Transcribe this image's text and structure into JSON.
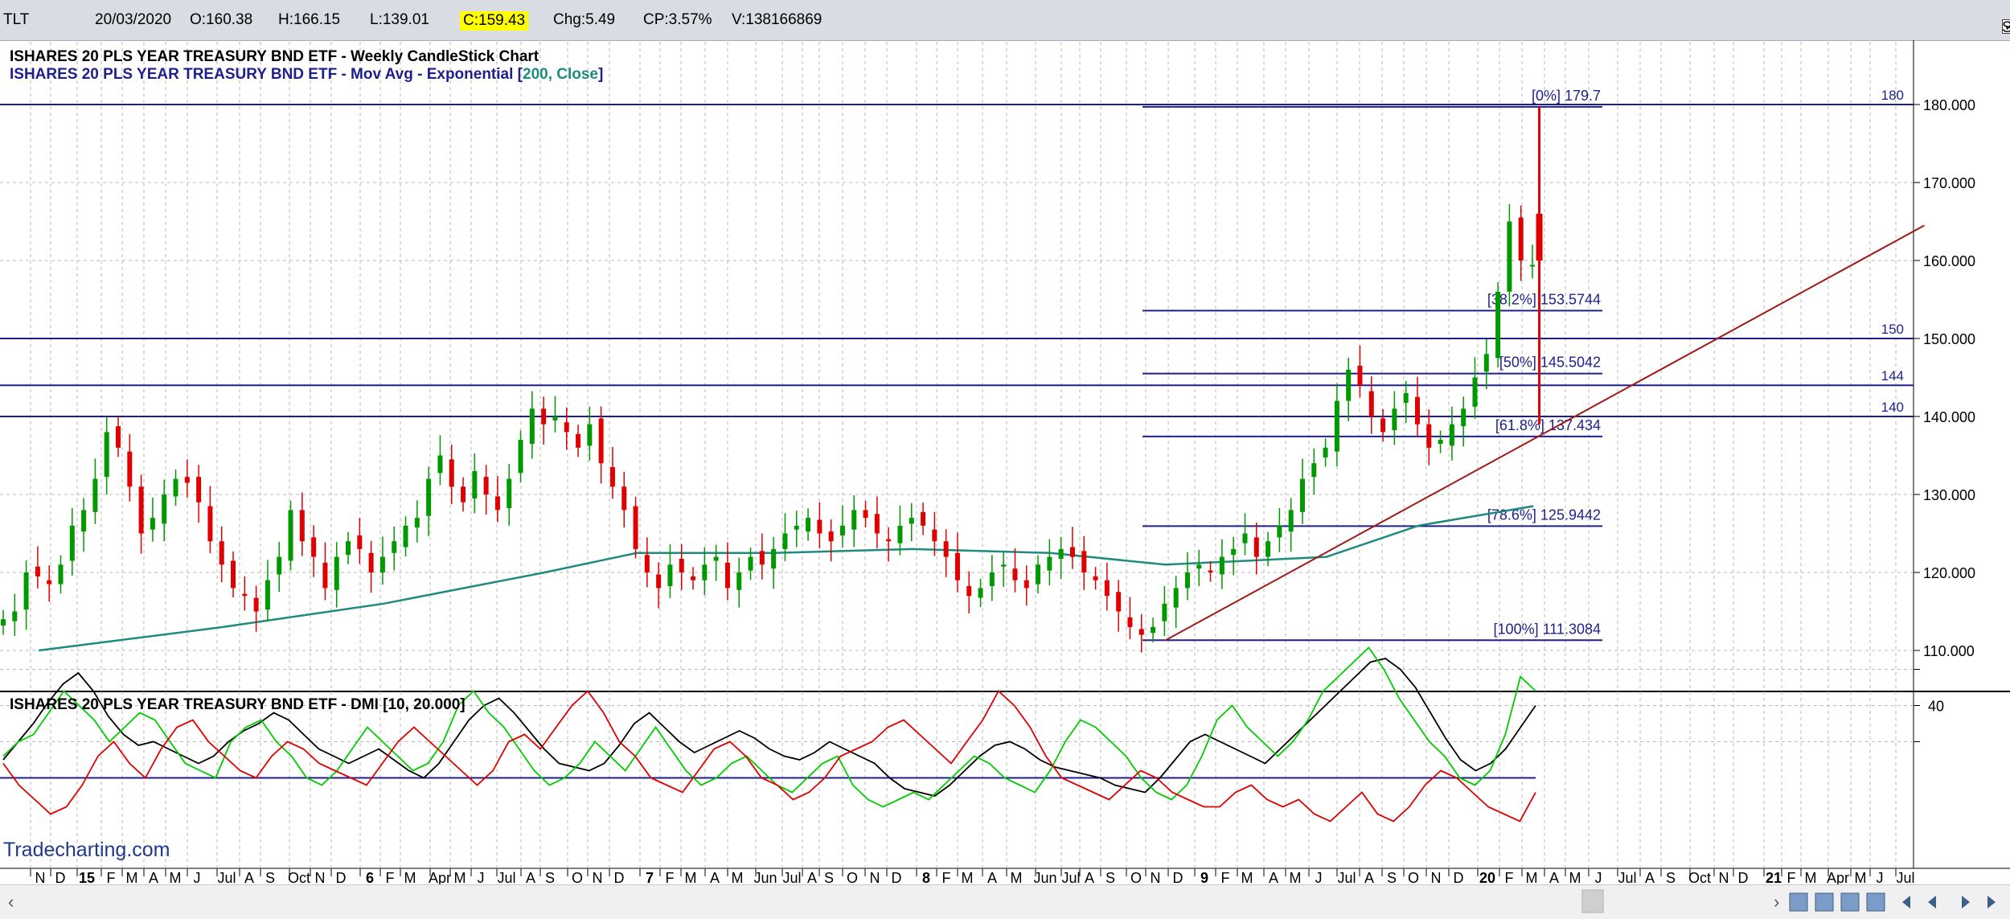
{
  "header": {
    "symbol": "TLT",
    "date": "20/03/2020",
    "open": "O:160.38",
    "high": "H:166.15",
    "low": "L:139.01",
    "close": "C:159.43",
    "change": "Chg:5.49",
    "change_pct": "CP:3.57%",
    "volume": "V:138166869",
    "show_last_label": "Show Last",
    "show_last_checked": true
  },
  "colors": {
    "up": "#009900",
    "down": "#e00000",
    "ema": "#1e8a80",
    "hline": "#1f1f8c",
    "trend": "#a01818",
    "plus_di": "#00cc00",
    "minus_di": "#e00000",
    "adx": "#000000",
    "grid": "#b8b8b8"
  },
  "icons": [
    "scroll-left-icon",
    "scroll-right-icon",
    "toolbar-icons",
    "nav-arrows-icon"
  ],
  "watermark": "Tradecharting.com",
  "chart_data": [
    {
      "type": "candlestick",
      "title": "ISHARES 20 PLS YEAR TREASURY BND ETF - Weekly CandleStick Chart",
      "subtitle_prefix": "ISHARES 20 PLS YEAR TREASURY BND ETF - Mov Avg - Exponential [",
      "subtitle_params": "200, Close",
      "subtitle_suffix": "]",
      "ylim": [
        105,
        185
      ],
      "y_ticks": [
        "110.000",
        "120.000",
        "130.000",
        "140.000",
        "150.000",
        "160.000",
        "170.000",
        "180.000"
      ],
      "horizontal_lines": [
        {
          "value": 180,
          "label": "180"
        },
        {
          "value": 150,
          "label": "150"
        },
        {
          "value": 144,
          "label": "144"
        },
        {
          "value": 140,
          "label": "140"
        }
      ],
      "fibonacci": {
        "start": "2018-10",
        "end": "2020-06",
        "levels": [
          {
            "value": 179.7,
            "label": "[0%] 179.7"
          },
          {
            "value": 153.5744,
            "label": "[38.2%] 153.5744"
          },
          {
            "value": 145.5042,
            "label": "[50%] 145.5042"
          },
          {
            "value": 137.434,
            "label": "[61.8%] 137.434"
          },
          {
            "value": 125.9442,
            "label": "[78.6%] 125.9442"
          },
          {
            "value": 111.3084,
            "label": "[100%] 111.3084"
          }
        ]
      },
      "trendline": {
        "from": {
          "x": "2018-11",
          "y": 111.3
        },
        "to": {
          "x": "2021-08",
          "y": 164.5
        }
      },
      "weekly_close": [
        114,
        115,
        120,
        119.5,
        118.5,
        121,
        126,
        128,
        132,
        138,
        136,
        131,
        125,
        127,
        130,
        132,
        131.5,
        129,
        124,
        121,
        118,
        117,
        115,
        119,
        122,
        128,
        124,
        122,
        118,
        122,
        124,
        123,
        120,
        122,
        124,
        126,
        127,
        132,
        135,
        131,
        129,
        133,
        130,
        128,
        132,
        137,
        141,
        139,
        140,
        138,
        136,
        139,
        134,
        131,
        128,
        123,
        120,
        118,
        121,
        120,
        119,
        121,
        122,
        118,
        120,
        122,
        121,
        123,
        125,
        126,
        127,
        125,
        124,
        126,
        128,
        127,
        125,
        124,
        126,
        127,
        126,
        124,
        122,
        119,
        117,
        118,
        120,
        121,
        119,
        118,
        121,
        122,
        123,
        122,
        120,
        119,
        117,
        115,
        113,
        112,
        113,
        116,
        118,
        120,
        121,
        120,
        122,
        123,
        125,
        122,
        124,
        126,
        128,
        132,
        134,
        136,
        142,
        146,
        144,
        140,
        138,
        141,
        143,
        139,
        136,
        137,
        139,
        141,
        145,
        148,
        156,
        165,
        160,
        159.43
      ],
      "weekly_high": [],
      "ema200": [
        {
          "x": "2014-10",
          "y": 110
        },
        {
          "x": "2015-06",
          "y": 113
        },
        {
          "x": "2016-01",
          "y": 116
        },
        {
          "x": "2016-08",
          "y": 120
        },
        {
          "x": "2016-12",
          "y": 122.5
        },
        {
          "x": "2017-06",
          "y": 122.5
        },
        {
          "x": "2017-12",
          "y": 123
        },
        {
          "x": "2018-06",
          "y": 122.5
        },
        {
          "x": "2018-11",
          "y": 121
        },
        {
          "x": "2019-06",
          "y": 122
        },
        {
          "x": "2019-10",
          "y": 126
        },
        {
          "x": "2020-03",
          "y": 128.5
        }
      ],
      "spike_week": {
        "x": "2020-03-09",
        "open": 166,
        "high": 179.7,
        "low": 139.01,
        "close": 160
      }
    },
    {
      "type": "line",
      "title": "ISHARES 20 PLS YEAR TREASURY BND ETF - DMI [10, 20.000]",
      "y_ticks": [
        "40"
      ],
      "threshold": 20,
      "ylim": [
        5,
        60
      ],
      "series": [
        {
          "key": "adx",
          "values": [
            25,
            30,
            35,
            41,
            46,
            49,
            44,
            37,
            32,
            29,
            30,
            28,
            26,
            24,
            26,
            30,
            33,
            35,
            38,
            36,
            32,
            28,
            26,
            24,
            26,
            28,
            25,
            22,
            20,
            24,
            30,
            36,
            40,
            42,
            38,
            33,
            28,
            24,
            23,
            22,
            24,
            29,
            35,
            38,
            34,
            30,
            27,
            29,
            31,
            33,
            31,
            28,
            26,
            25,
            27,
            30,
            28,
            26,
            24,
            20,
            17,
            16,
            15,
            18,
            22,
            26,
            29,
            30,
            28,
            25,
            23,
            22,
            21,
            20,
            18,
            17,
            16,
            20,
            25,
            30,
            32,
            30,
            28,
            26,
            24,
            28,
            32,
            36,
            40,
            44,
            48,
            52,
            53,
            50,
            45,
            38,
            31,
            25,
            22,
            24,
            28,
            34,
            40
          ]
        },
        {
          "key": "plus_di",
          "values": [
            26,
            30,
            32,
            38,
            44,
            40,
            36,
            30,
            34,
            38,
            36,
            30,
            24,
            22,
            20,
            30,
            34,
            36,
            30,
            26,
            20,
            18,
            22,
            28,
            34,
            30,
            26,
            22,
            24,
            30,
            40,
            44,
            38,
            34,
            28,
            22,
            18,
            20,
            24,
            30,
            26,
            22,
            28,
            34,
            28,
            22,
            18,
            20,
            24,
            26,
            22,
            18,
            16,
            20,
            24,
            26,
            18,
            14,
            12,
            14,
            16,
            14,
            18,
            22,
            26,
            24,
            20,
            18,
            16,
            22,
            30,
            36,
            34,
            30,
            26,
            20,
            16,
            14,
            18,
            26,
            36,
            40,
            34,
            30,
            26,
            30,
            36,
            44,
            48,
            52,
            56,
            50,
            42,
            36,
            30,
            26,
            20,
            18,
            22,
            32,
            48,
            44
          ]
        },
        {
          "key": "minus_di",
          "values": [
            24,
            18,
            14,
            10,
            12,
            18,
            26,
            30,
            24,
            20,
            28,
            34,
            36,
            30,
            26,
            22,
            20,
            26,
            30,
            28,
            24,
            22,
            20,
            18,
            24,
            30,
            34,
            30,
            26,
            22,
            18,
            22,
            30,
            32,
            28,
            34,
            40,
            44,
            38,
            30,
            26,
            20,
            18,
            16,
            22,
            28,
            30,
            26,
            20,
            18,
            14,
            16,
            20,
            26,
            28,
            30,
            34,
            36,
            32,
            28,
            24,
            30,
            36,
            44,
            40,
            34,
            26,
            20,
            18,
            16,
            14,
            18,
            22,
            20,
            16,
            14,
            12,
            12,
            16,
            18,
            14,
            12,
            14,
            10,
            8,
            12,
            16,
            10,
            8,
            12,
            18,
            22,
            20,
            16,
            12,
            10,
            8,
            16
          ]
        }
      ]
    }
  ],
  "x_axis": {
    "labels": [
      {
        "x": 50,
        "t": "N",
        "bold": false
      },
      {
        "x": 75,
        "t": "D",
        "bold": false
      },
      {
        "x": 108,
        "t": "15",
        "bold": true
      },
      {
        "x": 138,
        "t": "F",
        "bold": false
      },
      {
        "x": 164,
        "t": "M",
        "bold": false
      },
      {
        "x": 191,
        "t": "A",
        "bold": false
      },
      {
        "x": 218,
        "t": "M",
        "bold": false
      },
      {
        "x": 245,
        "t": "J",
        "bold": false
      },
      {
        "x": 282,
        "t": "Jul",
        "bold": false
      },
      {
        "x": 310,
        "t": "A",
        "bold": false
      },
      {
        "x": 336,
        "t": "S",
        "bold": false
      },
      {
        "x": 372,
        "t": "Oct",
        "bold": false
      },
      {
        "x": 398,
        "t": "N",
        "bold": false
      },
      {
        "x": 424,
        "t": "D",
        "bold": false
      },
      {
        "x": 460,
        "t": "6",
        "bold": true
      },
      {
        "x": 485,
        "t": "F",
        "bold": false
      },
      {
        "x": 510,
        "t": "M",
        "bold": false
      },
      {
        "x": 547,
        "t": "Apr",
        "bold": false
      },
      {
        "x": 572,
        "t": "M",
        "bold": false
      },
      {
        "x": 598,
        "t": "J",
        "bold": false
      },
      {
        "x": 630,
        "t": "Jul",
        "bold": false
      },
      {
        "x": 660,
        "t": "A",
        "bold": false
      },
      {
        "x": 684,
        "t": "S",
        "bold": false
      },
      {
        "x": 718,
        "t": "O",
        "bold": false
      },
      {
        "x": 743,
        "t": "N",
        "bold": false
      },
      {
        "x": 770,
        "t": "D",
        "bold": false
      },
      {
        "x": 808,
        "t": "7",
        "bold": true
      },
      {
        "x": 833,
        "t": "F",
        "bold": false
      },
      {
        "x": 859,
        "t": "M",
        "bold": false
      },
      {
        "x": 889,
        "t": "A",
        "bold": false
      },
      {
        "x": 917,
        "t": "M",
        "bold": false
      },
      {
        "x": 952,
        "t": "Jun",
        "bold": false
      },
      {
        "x": 985,
        "t": "Jul",
        "bold": false
      },
      {
        "x": 1010,
        "t": "A",
        "bold": false
      },
      {
        "x": 1031,
        "t": "S",
        "bold": false
      },
      {
        "x": 1060,
        "t": "O",
        "bold": false
      },
      {
        "x": 1088,
        "t": "N",
        "bold": false
      },
      {
        "x": 1115,
        "t": "D",
        "bold": false
      },
      {
        "x": 1152,
        "t": "8",
        "bold": true
      },
      {
        "x": 1177,
        "t": "F",
        "bold": false
      },
      {
        "x": 1203,
        "t": "M",
        "bold": false
      },
      {
        "x": 1234,
        "t": "A",
        "bold": false
      },
      {
        "x": 1264,
        "t": "M",
        "bold": false
      },
      {
        "x": 1300,
        "t": "Jun",
        "bold": false
      },
      {
        "x": 1332,
        "t": "Jul",
        "bold": false
      },
      {
        "x": 1355,
        "t": "A",
        "bold": false
      },
      {
        "x": 1381,
        "t": "S",
        "bold": false
      },
      {
        "x": 1413,
        "t": "O",
        "bold": false
      },
      {
        "x": 1437,
        "t": "N",
        "bold": false
      },
      {
        "x": 1465,
        "t": "D",
        "bold": false
      },
      {
        "x": 1498,
        "t": "9",
        "bold": true
      },
      {
        "x": 1524,
        "t": "F",
        "bold": false
      },
      {
        "x": 1551,
        "t": "M",
        "bold": false
      },
      {
        "x": 1584,
        "t": "A",
        "bold": false
      },
      {
        "x": 1611,
        "t": "M",
        "bold": false
      },
      {
        "x": 1640,
        "t": "J",
        "bold": false
      },
      {
        "x": 1675,
        "t": "Jul",
        "bold": false
      },
      {
        "x": 1703,
        "t": "A",
        "bold": false
      },
      {
        "x": 1731,
        "t": "S",
        "bold": false
      },
      {
        "x": 1758,
        "t": "O",
        "bold": false
      },
      {
        "x": 1786,
        "t": "N",
        "bold": false
      },
      {
        "x": 1814,
        "t": "D",
        "bold": false
      },
      {
        "x": 1850,
        "t": "20",
        "bold": true
      },
      {
        "x": 1877,
        "t": "F",
        "bold": false
      },
      {
        "x": 1905,
        "t": "M",
        "bold": false
      },
      {
        "x": 1933,
        "t": "A",
        "bold": false
      },
      {
        "x": 1959,
        "t": "M",
        "bold": false
      },
      {
        "x": 1988,
        "t": "J",
        "bold": false
      },
      {
        "x": 2024,
        "t": "Jul",
        "bold": false
      },
      {
        "x": 2052,
        "t": "A",
        "bold": false
      },
      {
        "x": 2078,
        "t": "S",
        "bold": false
      },
      {
        "x": 2114,
        "t": "Oct",
        "bold": false
      },
      {
        "x": 2144,
        "t": "N",
        "bold": false
      },
      {
        "x": 2168,
        "t": "D",
        "bold": false
      },
      {
        "x": 2206,
        "t": "21",
        "bold": true
      },
      {
        "x": 2228,
        "t": "F",
        "bold": false
      },
      {
        "x": 2252,
        "t": "M",
        "bold": false
      },
      {
        "x": 2286,
        "t": "Apr",
        "bold": false
      },
      {
        "x": 2314,
        "t": "M",
        "bold": false
      },
      {
        "x": 2338,
        "t": "J",
        "bold": false
      },
      {
        "x": 2370,
        "t": "Jul",
        "bold": false
      }
    ]
  }
}
